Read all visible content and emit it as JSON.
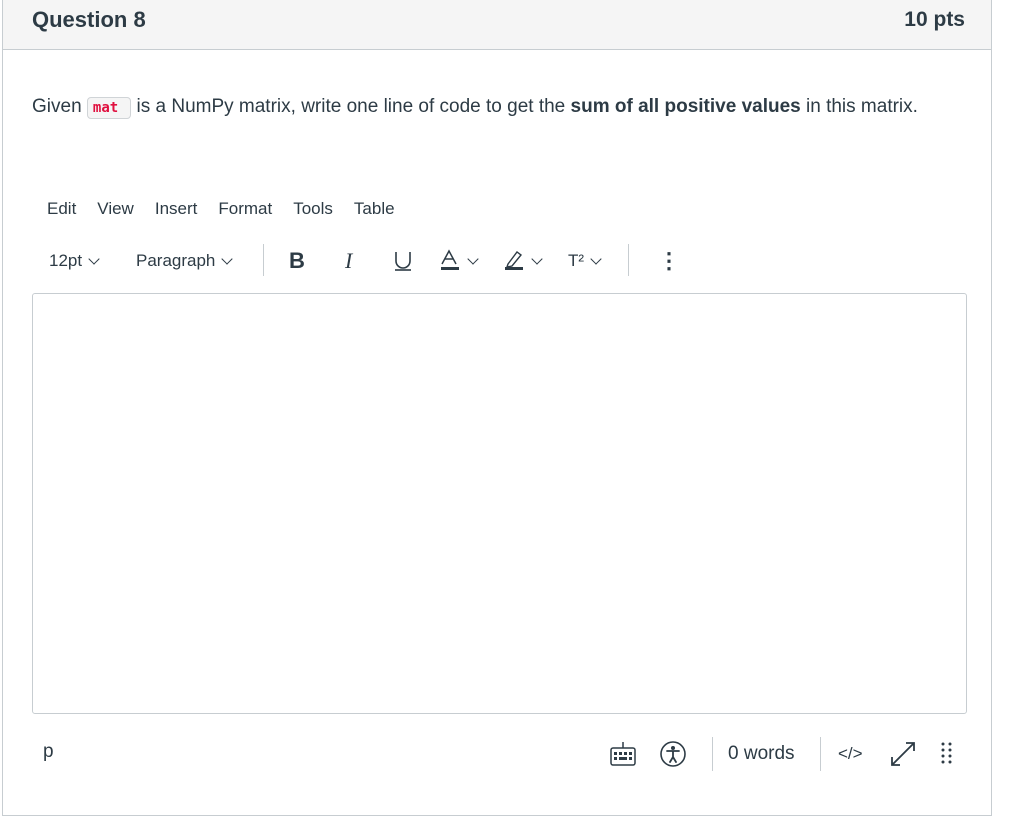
{
  "question": {
    "title": "Question 8",
    "points": "10 pts",
    "text_before": "Given ",
    "code": "mat",
    "text_middle": " is a NumPy matrix, write one line of code to get the ",
    "text_bold": "sum of all positive values",
    "text_after": " in this matrix."
  },
  "menubar": {
    "items": [
      "Edit",
      "View",
      "Insert",
      "Format",
      "Tools",
      "Table"
    ]
  },
  "toolbar": {
    "font_size": "12pt",
    "block_format": "Paragraph",
    "bold": "B",
    "italic": "I",
    "underline": "U",
    "text_color": "A",
    "superscript": "T²",
    "more": "⋮"
  },
  "editor": {
    "content": ""
  },
  "statusbar": {
    "path": "p",
    "word_count": "0 words",
    "html_toggle": "</>"
  },
  "colors": {
    "header_bg": "#f5f5f5",
    "border": "#c7cdd1",
    "text": "#2d3b45",
    "code_text": "#e0103f"
  }
}
